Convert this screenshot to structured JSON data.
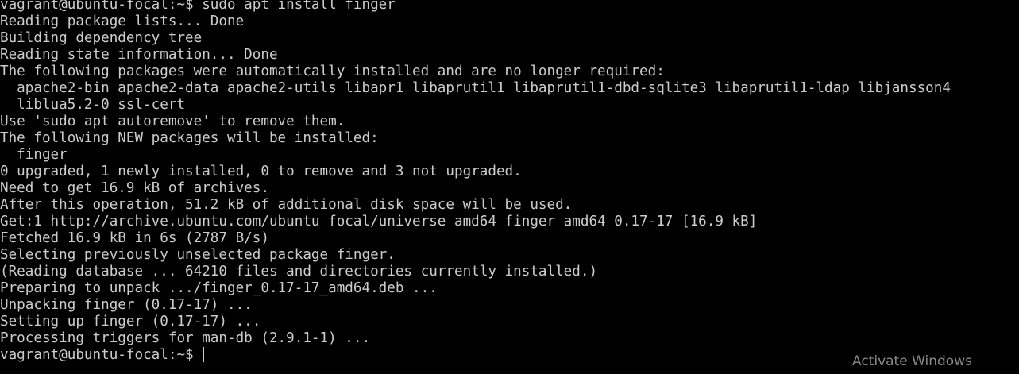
{
  "terminal": {
    "lines": [
      "vagrant@ubuntu-focal:~$ sudo apt install finger",
      "Reading package lists... Done",
      "Building dependency tree",
      "Reading state information... Done",
      "The following packages were automatically installed and are no longer required:",
      "  apache2-bin apache2-data apache2-utils libapr1 libaprutil1 libaprutil1-dbd-sqlite3 libaprutil1-ldap libjansson4",
      "  liblua5.2-0 ssl-cert",
      "Use 'sudo apt autoremove' to remove them.",
      "The following NEW packages will be installed:",
      "  finger",
      "0 upgraded, 1 newly installed, 0 to remove and 3 not upgraded.",
      "Need to get 16.9 kB of archives.",
      "After this operation, 51.2 kB of additional disk space will be used.",
      "Get:1 http://archive.ubuntu.com/ubuntu focal/universe amd64 finger amd64 0.17-17 [16.9 kB]",
      "Fetched 16.9 kB in 6s (2787 B/s)",
      "Selecting previously unselected package finger.",
      "(Reading database ... 64210 files and directories currently installed.)",
      "Preparing to unpack .../finger_0.17-17_amd64.deb ...",
      "Unpacking finger (0.17-17) ...",
      "Setting up finger (0.17-17) ...",
      "Processing triggers for man-db (2.9.1-1) ..."
    ],
    "prompt": "vagrant@ubuntu-focal:~$ ",
    "colors": {
      "background": "#000000",
      "foreground": "#cccccc"
    }
  },
  "watermark": {
    "text": "Activate Windows",
    "color": "#8a8a8a"
  }
}
